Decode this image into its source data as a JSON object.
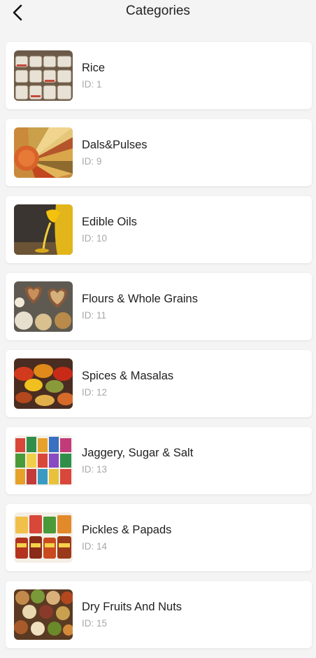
{
  "header": {
    "title": "Categories"
  },
  "categories": [
    {
      "name": "Rice",
      "id": "ID: 1",
      "image": "rice-sacks-image"
    },
    {
      "name": "Dals&Pulses",
      "id": "ID: 9",
      "image": "lentils-image"
    },
    {
      "name": "Edible Oils",
      "id": "ID: 10",
      "image": "oil-pour-image"
    },
    {
      "name": "Flours & Whole Grains",
      "id": "ID: 11",
      "image": "grains-bowls-image"
    },
    {
      "name": "Spices & Masalas",
      "id": "ID: 12",
      "image": "spices-image"
    },
    {
      "name": "Jaggery, Sugar & Salt",
      "id": "ID: 13",
      "image": "packets-image"
    },
    {
      "name": "Pickles & Papads",
      "id": "ID: 14",
      "image": "pickle-jars-image"
    },
    {
      "name": "Dry Fruits And Nuts",
      "id": "ID: 15",
      "image": "dry-fruits-image"
    }
  ]
}
